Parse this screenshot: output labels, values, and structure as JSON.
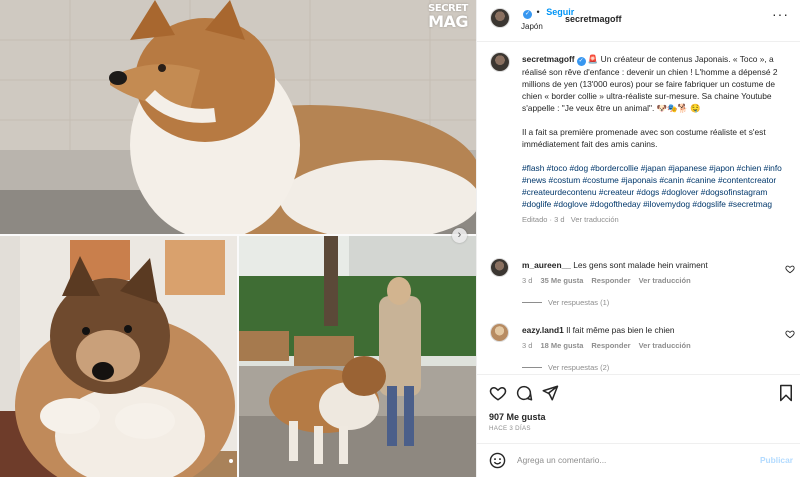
{
  "media": {
    "watermark_line1": "SECRET",
    "watermark_line2": "MAG",
    "next_icon": "chevron-right-icon"
  },
  "header": {
    "username": "secretmagoff",
    "follow_label": "Seguir",
    "separator": "•",
    "location": "Japón",
    "more_icon": "more-horizontal-icon"
  },
  "caption": {
    "username": "secretmagoff",
    "paragraph1": "🚨 Un créateur de contenus Japonais. « Toco », a réalisé son rêve d'enfance : devenir un chien ! L'homme a dépensé 2 millions de yen (13'000 euros) pour se faire fabriquer un costume de chien « border collie » ultra-réaliste sur-mesure. Sa chaine Youtube s'appelle : \"Je veux être un animal\". 🐶🎭🐕 🤤",
    "paragraph2": "Il a fait sa première promenade avec son costume réaliste et s'est immédiatement fait des amis canins.",
    "hashtags": "#flash #toco #dog #bordercollie #japan #japanese #japon #chien #info #news #costum #costume #japonais #canin #canine #contentcreator #createurdecontenu #createur #dogs #doglover #dogsofinstagram #doglife #doglove #dogoftheday #ilovemydog #dogslife #secretmag",
    "meta": "Editado · 3 d   Ver traducción"
  },
  "comments": [
    {
      "username": "m_aureen__",
      "text": "Les gens sont malade hein vraiment",
      "time": "3 d",
      "likes": "35 Me gusta",
      "reply": "Responder",
      "translate": "Ver traducción",
      "replies": "Ver respuestas (1)"
    },
    {
      "username": "eazy.land1",
      "text": "Il fait même pas bien le chien",
      "time": "3 d",
      "likes": "18 Me gusta",
      "reply": "Responder",
      "translate": "Ver traducción",
      "replies": "Ver respuestas (2)"
    }
  ],
  "actions": {
    "likes": "907 Me gusta",
    "time": "HACE 3 DÍAS",
    "icons": [
      "heart-icon",
      "comment-icon",
      "share-icon",
      "bookmark-icon"
    ]
  },
  "add_comment": {
    "placeholder": "Agrega un comentario...",
    "post_label": "Publicar"
  },
  "colors": {
    "link": "#00376b",
    "accent": "#0095f6",
    "verified": "#3897f0",
    "muted": "#8e8e8e",
    "publish_disabled": "#b3dbff"
  }
}
